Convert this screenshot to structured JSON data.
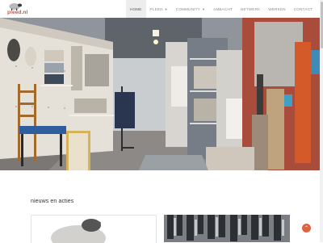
{
  "site": {
    "logo_text": "pleed.nl"
  },
  "nav": {
    "items": [
      {
        "label": "HOME",
        "active": true,
        "has_dropdown": false
      },
      {
        "label": "PLEED",
        "active": false,
        "has_dropdown": true
      },
      {
        "label": "COMMUNITY",
        "active": false,
        "has_dropdown": true
      },
      {
        "label": "AMBACHT",
        "active": false,
        "has_dropdown": false
      },
      {
        "label": "NETWERK",
        "active": false,
        "has_dropdown": false
      },
      {
        "label": "WERKEN",
        "active": false,
        "has_dropdown": false
      },
      {
        "label": "CONTACT",
        "active": false,
        "has_dropdown": false
      }
    ],
    "dropdown_icon": "caret-down-icon"
  },
  "news": {
    "heading": "nieuws en acties"
  },
  "colors": {
    "brand": "#d1533d",
    "back_to_top": "#e0623f",
    "nav_active_bg": "#ededed"
  }
}
